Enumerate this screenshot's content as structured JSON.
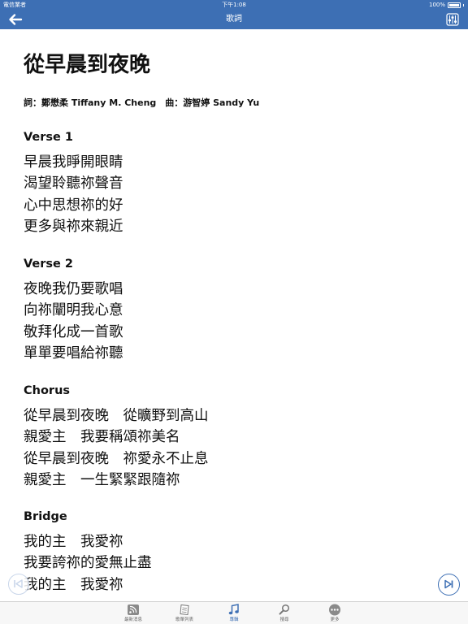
{
  "status_bar": {
    "carrier": "電信業者",
    "time": "下午1:08",
    "battery_text": "100%"
  },
  "nav": {
    "title": "歌詞"
  },
  "song": {
    "title": "從早晨到夜晚",
    "credits": "詞：鄭懋柔 Tiffany M. Cheng　曲：游智婷 Sandy Yu",
    "sections": [
      {
        "heading": "Verse 1",
        "lines": [
          "早晨我睜開眼睛",
          "渴望聆聽祢聲音",
          "心中思想祢的好",
          "更多與祢來親近"
        ]
      },
      {
        "heading": "Verse 2",
        "lines": [
          "夜晚我仍要歌唱",
          "向祢闡明我心意",
          "敬拜化成一首歌",
          "單單要唱給祢聽"
        ]
      },
      {
        "heading": "Chorus",
        "lines": [
          "從早晨到夜晚　從曠野到高山",
          "親愛主　我要稱頌祢美名",
          "從早晨到夜晚　祢愛永不止息",
          "親愛主　一生緊緊跟隨祢"
        ]
      },
      {
        "heading": "Bridge",
        "lines": [
          "我的主　我愛祢",
          "我要誇祢的愛無止盡",
          "我的主　我愛祢"
        ]
      }
    ]
  },
  "tabs": [
    {
      "label": "最新消息",
      "icon": "rss-icon",
      "active": false
    },
    {
      "label": "歌單列表",
      "icon": "songlist-icon",
      "active": false
    },
    {
      "label": "專輯",
      "icon": "music-note-icon",
      "active": true
    },
    {
      "label": "搜尋",
      "icon": "search-icon",
      "active": false
    },
    {
      "label": "更多",
      "icon": "more-icon",
      "active": false
    }
  ],
  "colors": {
    "accent": "#3d6fb4",
    "tab_inactive": "#666666",
    "background": "#ffffff"
  }
}
